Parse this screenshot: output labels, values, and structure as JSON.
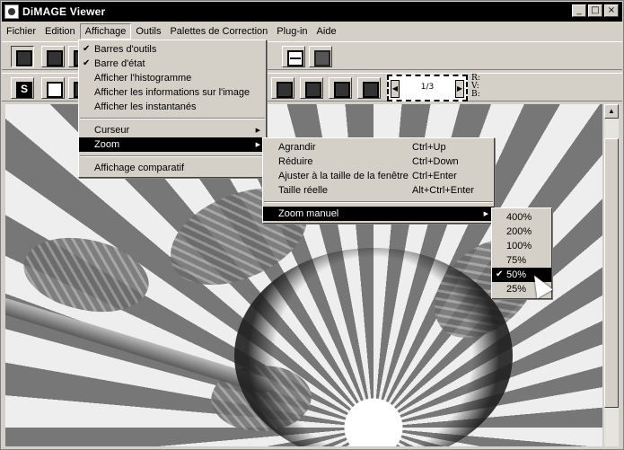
{
  "window": {
    "title": "DiMAGE Viewer",
    "controls": [
      "_",
      "□",
      "×"
    ]
  },
  "menubar": {
    "items": [
      "Fichier",
      "Edition",
      "Affichage",
      "Outils",
      "Palettes de Correction",
      "Plug-in",
      "Aide"
    ],
    "active": "Affichage"
  },
  "affichage_menu": {
    "items": [
      {
        "label": "Barres d'outils",
        "checked": true
      },
      {
        "label": "Barre d'état",
        "checked": true
      },
      {
        "label": "Afficher l'histogramme",
        "checked": false
      },
      {
        "label": "Afficher les informations sur l'image",
        "checked": false
      },
      {
        "label": "Afficher les instantanés",
        "checked": false
      },
      {
        "label": "Curseur",
        "submenu": true
      },
      {
        "label": "Zoom",
        "submenu": true,
        "highlighted": true
      },
      {
        "label": "Affichage comparatif"
      }
    ]
  },
  "zoom_menu": {
    "items": [
      {
        "label": "Agrandir",
        "shortcut": "Ctrl+Up"
      },
      {
        "label": "Réduire",
        "shortcut": "Ctrl+Down"
      },
      {
        "label": "Ajuster à la taille de la fenêtre",
        "shortcut": "Ctrl+Enter"
      },
      {
        "label": "Taille réelle",
        "shortcut": "Alt+Ctrl+Enter"
      },
      {
        "label": "Zoom manuel",
        "submenu": true,
        "highlighted": true
      }
    ]
  },
  "zoom_manuel_menu": {
    "items": [
      "400%",
      "200%",
      "100%",
      "75%",
      "50%",
      "25%"
    ],
    "selected": "50%"
  },
  "frame_navigator": {
    "counter": "1/3",
    "left_arrow": "◀",
    "right_arrow": "▶"
  },
  "rgb_readout": {
    "r": "R:",
    "v": "V:",
    "b": "B:"
  },
  "scrollbar": {
    "up_arrow": "▲"
  },
  "colors": {
    "title_bar": "#000000",
    "chrome": "#d4d0c8",
    "highlight": "#000000",
    "highlight_text": "#ffffff"
  }
}
